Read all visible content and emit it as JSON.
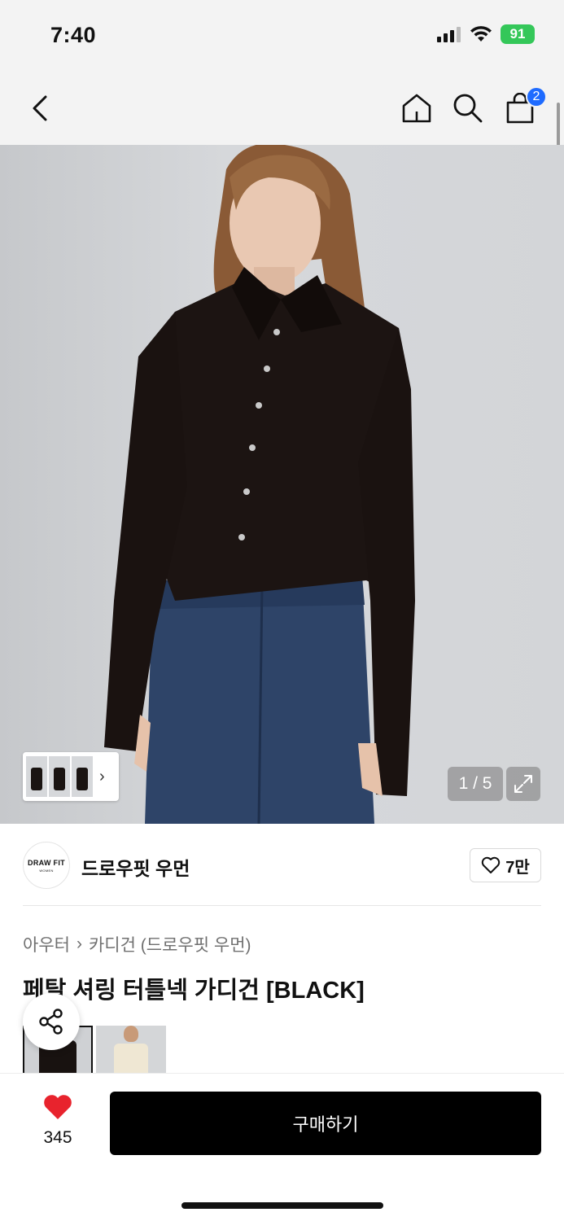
{
  "status_bar": {
    "time": "7:40",
    "battery": "91"
  },
  "nav": {
    "cart_count": "2"
  },
  "gallery": {
    "pager": "1 / 5",
    "thumb_strip_arrow": "›"
  },
  "brand": {
    "logo_text": "DRAW FIT",
    "logo_sub": "WOMEN",
    "name": "드로우핏 우먼",
    "like_count": "7만"
  },
  "breadcrumb": {
    "category": "아우터",
    "separator": "›",
    "subcategory": "카디건 (드로우핏 우먼)"
  },
  "product": {
    "title": "페탈 셔링 터틀넥 가디건 [BLACK]"
  },
  "bottom": {
    "wish_count": "345",
    "buy_label": "구매하기"
  },
  "colors": {
    "accent_badge": "#1e6bff",
    "wish_heart": "#e8232d",
    "battery": "#34c759",
    "buy_button": "#000000"
  }
}
